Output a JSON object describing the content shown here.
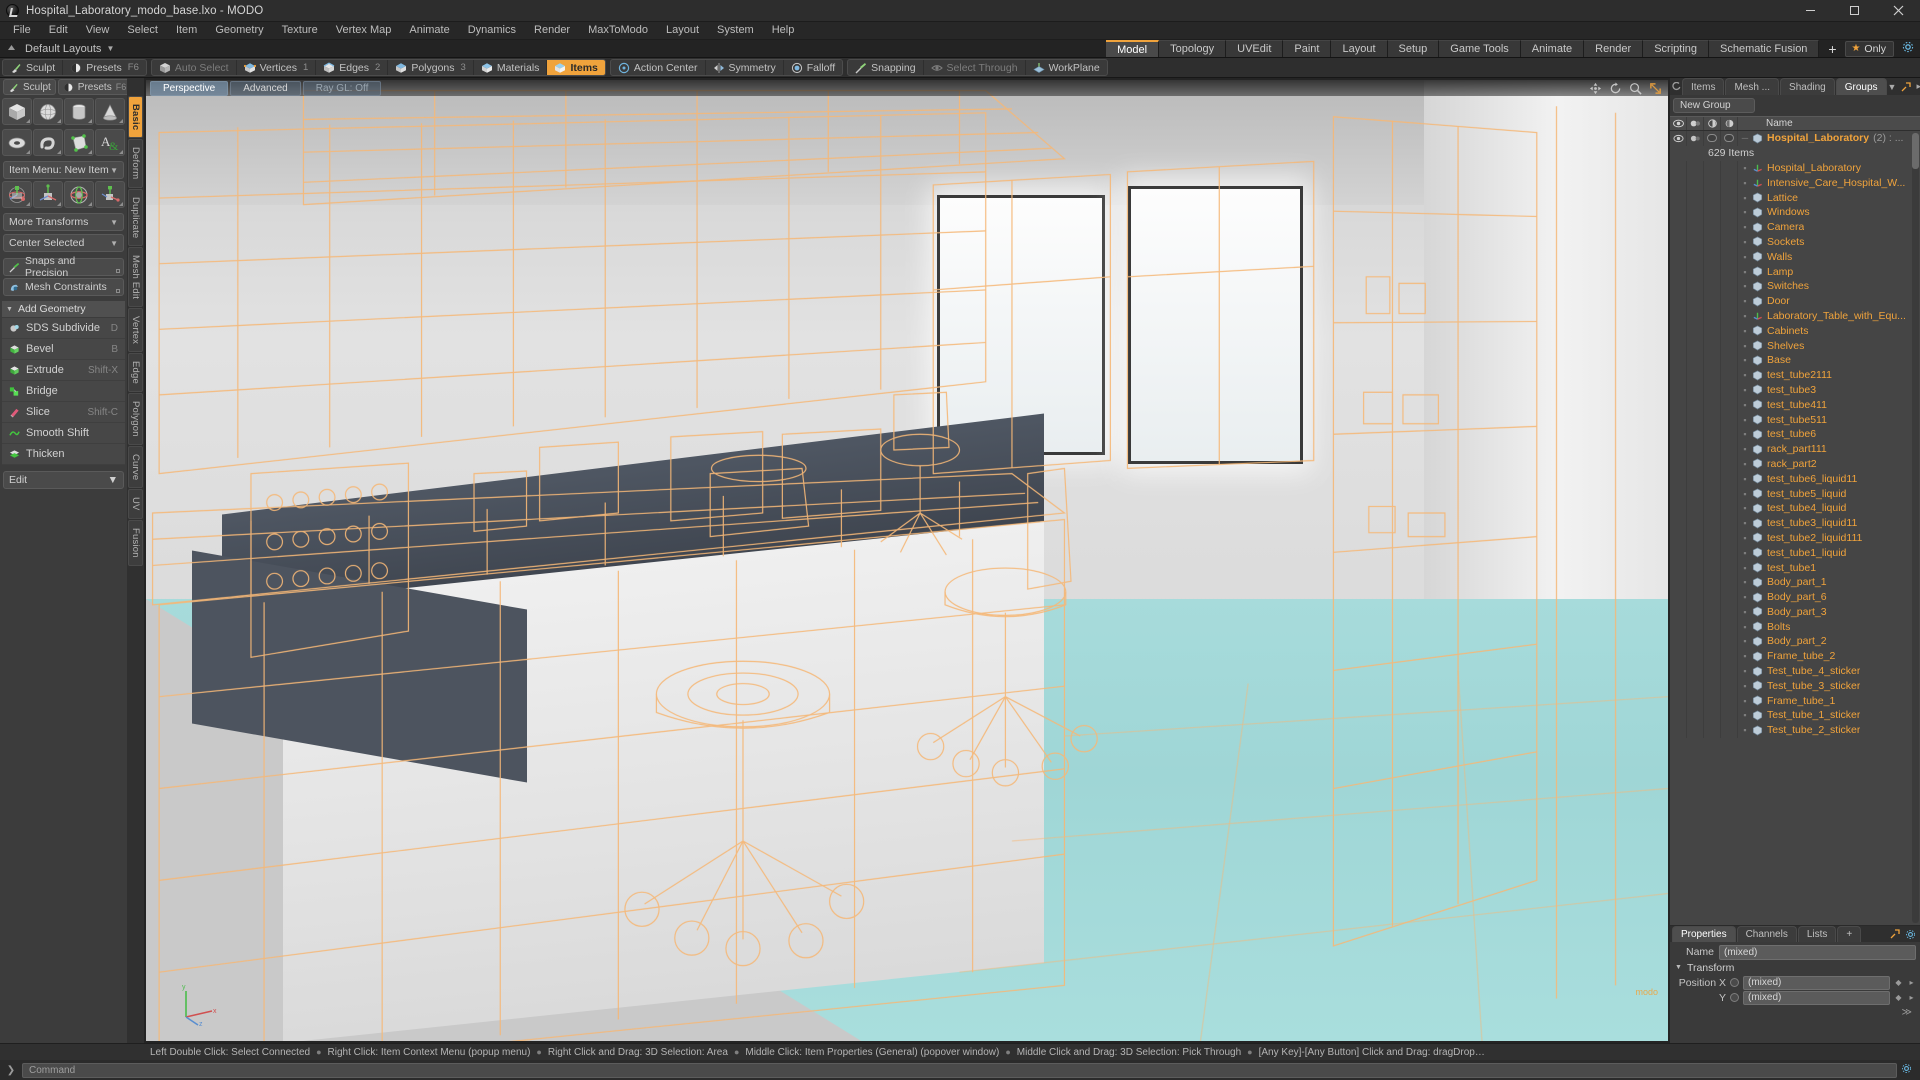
{
  "titlebar": {
    "title": "Hospital_Laboratory_modo_base.lxo - MODO",
    "minimize": "─",
    "maximize": "❐",
    "close": "✕"
  },
  "menubar": {
    "items": [
      "File",
      "Edit",
      "View",
      "Select",
      "Item",
      "Geometry",
      "Texture",
      "Vertex Map",
      "Animate",
      "Dynamics",
      "Render",
      "MaxToModo",
      "Layout",
      "System",
      "Help"
    ]
  },
  "layoutbar": {
    "default_layouts": "Default Layouts",
    "caret": "▼",
    "tabs": [
      "Model",
      "Topology",
      "UVEdit",
      "Paint",
      "Layout",
      "Setup",
      "Game Tools",
      "Animate",
      "Render",
      "Scripting",
      "Schematic Fusion"
    ],
    "active_tab": "Model",
    "add_tab": "+",
    "only_label": "Only",
    "star": "★"
  },
  "modebar": {
    "group1": [
      {
        "label": "Sculpt",
        "icon": "sculpt-brush-icon",
        "shortcut": ""
      },
      {
        "label": "Presets",
        "icon": "presets-sphere-icon",
        "shortcut": "F6"
      }
    ],
    "group2": [
      {
        "label": "Auto Select",
        "icon": "cube-grey-icon",
        "num": "",
        "state": "dim"
      },
      {
        "label": "Vertices",
        "icon": "cube-vertices-icon",
        "num": "1",
        "state": "normal"
      },
      {
        "label": "Edges",
        "icon": "cube-edges-icon",
        "num": "2",
        "state": "normal"
      },
      {
        "label": "Polygons",
        "icon": "cube-polygons-icon",
        "num": "3",
        "state": "normal"
      },
      {
        "label": "Materials",
        "icon": "cube-materials-icon",
        "num": "",
        "state": "normal"
      },
      {
        "label": "Items",
        "icon": "cube-items-icon",
        "num": "",
        "state": "active"
      }
    ],
    "group3": [
      {
        "label": "Action Center",
        "icon": "action-center-icon",
        "state": "normal"
      },
      {
        "label": "Symmetry",
        "icon": "symmetry-icon",
        "state": "normal"
      },
      {
        "label": "Falloff",
        "icon": "falloff-icon",
        "state": "normal"
      }
    ],
    "group4": [
      {
        "label": "Snapping",
        "icon": "snapping-icon",
        "state": "normal"
      },
      {
        "label": "Select Through",
        "icon": "select-through-icon",
        "state": "dim"
      },
      {
        "label": "WorkPlane",
        "icon": "workplane-icon",
        "state": "normal"
      }
    ]
  },
  "leftpanel": {
    "sculpt": {
      "label": "Sculpt",
      "icon": "sculpt-brush-icon"
    },
    "presets": {
      "label": "Presets",
      "icon": "presets-sphere-icon",
      "shortcut": "F6"
    },
    "primitives_row1": [
      "cube-primitive-icon",
      "sphere-primitive-icon",
      "cylinder-primitive-icon",
      "cone-primitive-icon"
    ],
    "primitives_row2": [
      "torus-primitive-icon",
      "spiral-primitive-icon",
      "polygon-pen-icon",
      "text-tool-icon"
    ],
    "item_menu": {
      "label": "Item Menu: New Item",
      "caret": "▼"
    },
    "transform_icons": [
      "move-gizmo-icon",
      "scale-gizmo-icon",
      "rotate-gizmo-icon",
      "transform-gizmo-icon"
    ],
    "more_transforms": {
      "label": "More Transforms",
      "caret": "▼"
    },
    "center_selected": {
      "label": "Center Selected",
      "caret": "▼"
    },
    "snaps": {
      "label": "Snaps and Precision",
      "icon": "snap-magnet-icon"
    },
    "mesh_constraints": {
      "label": "Mesh Constraints",
      "icon": "mesh-constraint-icon"
    },
    "add_geometry": {
      "label": "Add Geometry",
      "tri": "▼"
    },
    "tools": [
      {
        "label": "SDS Subdivide",
        "shortcut": "D",
        "icon": "sds-subdivide-icon"
      },
      {
        "label": "Bevel",
        "shortcut": "B",
        "icon": "bevel-icon"
      },
      {
        "label": "Extrude",
        "shortcut": "Shift-X",
        "icon": "extrude-icon"
      },
      {
        "label": "Bridge",
        "shortcut": "",
        "icon": "bridge-icon"
      },
      {
        "label": "Slice",
        "shortcut": "Shift-C",
        "icon": "slice-icon"
      },
      {
        "label": "Smooth Shift",
        "shortcut": "",
        "icon": "smooth-shift-icon"
      },
      {
        "label": "Thicken",
        "shortcut": "",
        "icon": "thicken-icon"
      }
    ],
    "edit": {
      "label": "Edit",
      "caret": "▼"
    }
  },
  "vtabs": {
    "items": [
      "Basic",
      "Deform",
      "Duplicate",
      "Mesh Edit",
      "Vertex",
      "Edge",
      "Polygon",
      "Curve",
      "UV",
      "Fusion"
    ],
    "active": "Basic"
  },
  "viewport": {
    "tabs": [
      {
        "label": "Perspective",
        "state": "sel"
      },
      {
        "label": "Advanced",
        "state": "normal"
      },
      {
        "label": "Ray GL: Off",
        "state": "dim"
      }
    ],
    "corner_icons": [
      "pan-icon",
      "rotate-icon",
      "zoom-icon",
      "fit-icon"
    ],
    "axis": {
      "x": "x",
      "y": "y",
      "z": "z"
    },
    "watermark": "modo"
  },
  "rightpanel": {
    "tabs": [
      {
        "label": "Items",
        "active": false
      },
      {
        "label": "Mesh ...",
        "active": false
      },
      {
        "label": "Shading",
        "active": false
      },
      {
        "label": "Groups",
        "active": true
      }
    ],
    "tab_caret": "▼",
    "new_group": "New Group",
    "list_header": {
      "col_visible": "eye-icon",
      "col_render": "render-icon",
      "col_shade1": "shade-icon-1",
      "col_shade2": "shade-icon-2",
      "name": "Name"
    },
    "root": {
      "label": "Hospital_Laboratory",
      "count": "(2) : ...",
      "subtext": "629 Items"
    },
    "items": [
      {
        "label": "Hospital_Laboratory",
        "icon": "locator-axis-icon"
      },
      {
        "label": "Intensive_Care_Hospital_W...",
        "icon": "locator-axis-icon"
      },
      {
        "label": "Lattice",
        "icon": "mesh-icon"
      },
      {
        "label": "Windows",
        "icon": "mesh-icon"
      },
      {
        "label": "Camera",
        "icon": "mesh-icon"
      },
      {
        "label": "Sockets",
        "icon": "mesh-icon"
      },
      {
        "label": "Walls",
        "icon": "mesh-icon"
      },
      {
        "label": "Lamp",
        "icon": "mesh-icon"
      },
      {
        "label": "Switches",
        "icon": "mesh-icon"
      },
      {
        "label": "Door",
        "icon": "mesh-icon"
      },
      {
        "label": "Laboratory_Table_with_Equ...",
        "icon": "locator-axis-icon"
      },
      {
        "label": "Cabinets",
        "icon": "mesh-icon"
      },
      {
        "label": "Shelves",
        "icon": "mesh-icon"
      },
      {
        "label": "Base",
        "icon": "mesh-icon"
      },
      {
        "label": "test_tube2111",
        "icon": "mesh-icon"
      },
      {
        "label": "test_tube3",
        "icon": "mesh-icon"
      },
      {
        "label": "test_tube411",
        "icon": "mesh-icon"
      },
      {
        "label": "test_tube511",
        "icon": "mesh-icon"
      },
      {
        "label": "test_tube6",
        "icon": "mesh-icon"
      },
      {
        "label": "rack_part111",
        "icon": "mesh-icon"
      },
      {
        "label": "rack_part2",
        "icon": "mesh-icon"
      },
      {
        "label": "test_tube6_liquid11",
        "icon": "mesh-icon"
      },
      {
        "label": "test_tube5_liquid",
        "icon": "mesh-icon"
      },
      {
        "label": "test_tube4_liquid",
        "icon": "mesh-icon"
      },
      {
        "label": "test_tube3_liquid11",
        "icon": "mesh-icon"
      },
      {
        "label": "test_tube2_liquid111",
        "icon": "mesh-icon"
      },
      {
        "label": "test_tube1_liquid",
        "icon": "mesh-icon"
      },
      {
        "label": "test_tube1",
        "icon": "mesh-icon"
      },
      {
        "label": "Body_part_1",
        "icon": "mesh-icon"
      },
      {
        "label": "Body_part_6",
        "icon": "mesh-icon"
      },
      {
        "label": "Body_part_3",
        "icon": "mesh-icon"
      },
      {
        "label": "Bolts",
        "icon": "mesh-icon"
      },
      {
        "label": "Body_part_2",
        "icon": "mesh-icon"
      },
      {
        "label": "Frame_tube_2",
        "icon": "mesh-icon"
      },
      {
        "label": "Test_tube_4_sticker",
        "icon": "mesh-icon"
      },
      {
        "label": "Test_tube_3_sticker",
        "icon": "mesh-icon"
      },
      {
        "label": "Frame_tube_1",
        "icon": "mesh-icon"
      },
      {
        "label": "Test_tube_1_sticker",
        "icon": "mesh-icon"
      },
      {
        "label": "Test_tube_2_sticker",
        "icon": "mesh-icon"
      }
    ],
    "properties": {
      "tabs": [
        {
          "label": "Properties",
          "active": true
        },
        {
          "label": "Channels",
          "active": false
        },
        {
          "label": "Lists",
          "active": false
        },
        {
          "label": "+",
          "active": false
        }
      ],
      "name_label": "Name",
      "name_value": "(mixed)",
      "transform_section": "Transform",
      "transform_tri": "▼",
      "rows": [
        {
          "label": "Position X",
          "value": "(mixed)"
        },
        {
          "label": "Y",
          "value": "(mixed)"
        }
      ]
    }
  },
  "statusbar": {
    "segments": [
      "Left Double Click: Select Connected",
      "Right Click: Item Context Menu (popup menu)",
      "Right Click and Drag: 3D Selection: Area",
      "Middle Click: Item Properties (General) (popover window)",
      "Middle Click and Drag: 3D Selection: Pick Through",
      "[Any Key]-[Any Button] Click and Drag: dragDrop…"
    ],
    "bullet": "●"
  },
  "commandbar": {
    "arrow": "❯",
    "placeholder": "Command"
  },
  "colors": {
    "accent": "#f0a33c",
    "wireframe": "#f5b878",
    "floor": "#a7dbdb",
    "panel_bg": "#3c3c3c",
    "viewport_bg": "#9b9b9b"
  }
}
